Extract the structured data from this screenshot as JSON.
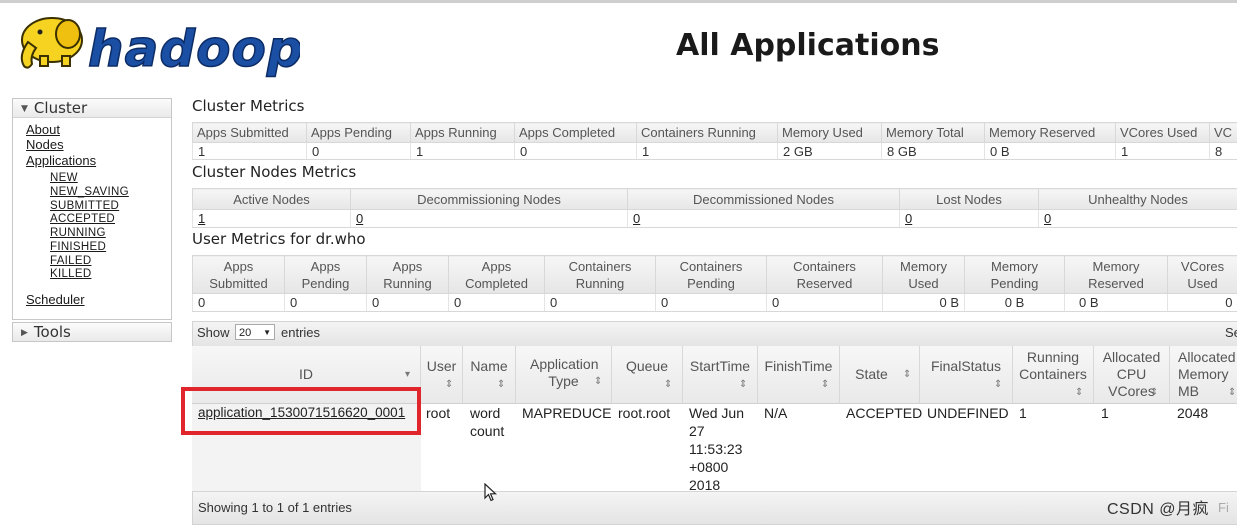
{
  "header": {
    "logo_text": "hadoop",
    "title": "All Applications"
  },
  "sidebar": {
    "cluster_label": "Cluster",
    "links": [
      "About",
      "Nodes",
      "Applications"
    ],
    "app_states": [
      "NEW",
      "NEW_SAVING",
      "SUBMITTED",
      "ACCEPTED",
      "RUNNING",
      "FINISHED",
      "FAILED",
      "KILLED"
    ],
    "scheduler_label": "Scheduler",
    "tools_label": "Tools"
  },
  "cluster_metrics": {
    "title": "Cluster Metrics",
    "headers": [
      "Apps Submitted",
      "Apps Pending",
      "Apps Running",
      "Apps Completed",
      "Containers Running",
      "Memory Used",
      "Memory Total",
      "Memory Reserved",
      "VCores Used",
      "VC"
    ],
    "values": [
      "1",
      "0",
      "1",
      "0",
      "1",
      "2 GB",
      "8 GB",
      "0 B",
      "1",
      "8"
    ]
  },
  "nodes_metrics": {
    "title": "Cluster Nodes Metrics",
    "headers": [
      "Active Nodes",
      "Decommissioning Nodes",
      "Decommissioned Nodes",
      "Lost Nodes",
      "Unhealthy Nodes"
    ],
    "values": [
      "1",
      "0",
      "0",
      "0",
      "0"
    ]
  },
  "user_metrics": {
    "title": "User Metrics for dr.who",
    "headers": [
      "Apps Submitted",
      "Apps Pending",
      "Apps Running",
      "Apps Completed",
      "Containers Running",
      "Containers Pending",
      "Containers Reserved",
      "Memory Used",
      "Memory Pending",
      "Memory Reserved",
      "VCores Used"
    ],
    "values": [
      "0",
      "0",
      "0",
      "0",
      "0",
      "0",
      "0",
      "0 B",
      "0 B",
      "0 B",
      "0"
    ]
  },
  "apps": {
    "show_label": "Show",
    "entries_label": "entries",
    "page_size": "20",
    "search_cut": "Se",
    "columns": [
      "ID",
      "User",
      "Name",
      "Application Type",
      "Queue",
      "StartTime",
      "FinishTime",
      "State",
      "FinalStatus",
      "Running Containers",
      "Allocated CPU VCores",
      "Allocated Memory MB"
    ],
    "row": {
      "id": "application_1530071516620_0001",
      "user": "root",
      "name": "word count",
      "type": "MAPREDUCE",
      "queue": "root.root",
      "start": "Wed Jun 27 11:53:23 +0800 2018",
      "finish": "N/A",
      "state": "ACCEPTED",
      "final_status": "UNDEFINED",
      "running_containers": "1",
      "vcores": "1",
      "memory": "2048"
    },
    "footer": "Showing 1 to 1 of 1 entries",
    "footer_cut": "Fi"
  },
  "watermark": "CSDN @月疯",
  "colors": {
    "highlight": "#e0262b",
    "logo_yellow": "#f5d320",
    "logo_blue": "#1a4fa3"
  }
}
